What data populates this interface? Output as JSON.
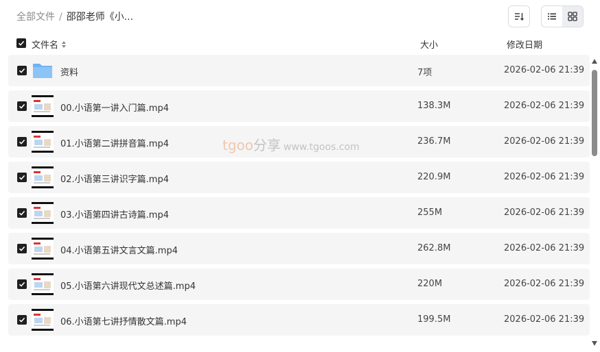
{
  "breadcrumb": {
    "root": "全部文件",
    "separator": "/",
    "current": "邵邵老师《小..."
  },
  "toolbar": {
    "sort_icon": "sort-icon",
    "list_view_icon": "list-view-icon",
    "grid_view_icon": "grid-view-icon",
    "active_view": "list"
  },
  "columns": {
    "name": "文件名",
    "size": "大小",
    "date": "修改日期"
  },
  "watermark": {
    "brand": "tgoo",
    "cn": "分享",
    "url": "www.tgoos.com"
  },
  "files": [
    {
      "name": "资料",
      "size": "7项",
      "date": "2026-02-06 21:39",
      "type": "folder",
      "checked": true
    },
    {
      "name": "00.小语第一讲入门篇.mp4",
      "size": "138.3M",
      "date": "2026-02-06 21:39",
      "type": "video",
      "checked": true
    },
    {
      "name": "01.小语第二讲拼音篇.mp4",
      "size": "236.7M",
      "date": "2026-02-06 21:39",
      "type": "video",
      "checked": true
    },
    {
      "name": "02.小语第三讲识字篇.mp4",
      "size": "220.9M",
      "date": "2026-02-06 21:39",
      "type": "video",
      "checked": true
    },
    {
      "name": "03.小语第四讲古诗篇.mp4",
      "size": "255M",
      "date": "2026-02-06 21:39",
      "type": "video",
      "checked": true
    },
    {
      "name": "04.小语第五讲文言文篇.mp4",
      "size": "262.8M",
      "date": "2026-02-06 21:39",
      "type": "video",
      "checked": true
    },
    {
      "name": "05.小语第六讲现代文总述篇.mp4",
      "size": "220M",
      "date": "2026-02-06 21:39",
      "type": "video",
      "checked": true
    },
    {
      "name": "06.小语第七讲抒情散文篇.mp4",
      "size": "199.5M",
      "date": "2026-02-06 21:39",
      "type": "video",
      "checked": true
    }
  ]
}
